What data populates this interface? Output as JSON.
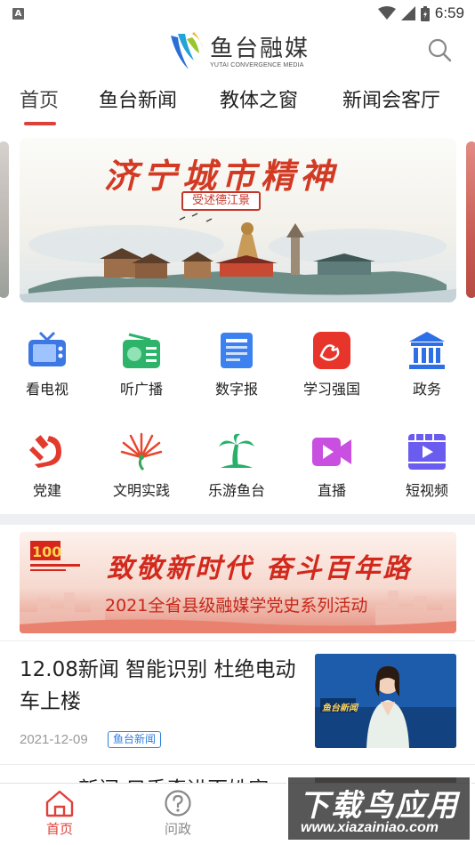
{
  "status_bar": {
    "time": "6:59",
    "app_icon_letter": "A"
  },
  "header": {
    "logo_cn": "鱼台融媒",
    "logo_en": "YUTAI CONVERGENCE MEDIA"
  },
  "tabs": [
    {
      "label": "首页",
      "active": true
    },
    {
      "label": "鱼台新闻",
      "active": false
    },
    {
      "label": "教体之窗",
      "active": false
    },
    {
      "label": "新闻会客厅",
      "active": false
    }
  ],
  "banner": {
    "title": "济宁城市精神",
    "subtitle": "受述德江景"
  },
  "grid": [
    {
      "label": "看电视",
      "icon": "tv-icon"
    },
    {
      "label": "听广播",
      "icon": "radio-icon"
    },
    {
      "label": "数字报",
      "icon": "newspaper-icon"
    },
    {
      "label": "学习强国",
      "icon": "xuexi-icon"
    },
    {
      "label": "政务",
      "icon": "government-icon"
    },
    {
      "label": "党建",
      "icon": "party-icon"
    },
    {
      "label": "文明实践",
      "icon": "civilization-icon"
    },
    {
      "label": "乐游鱼台",
      "icon": "palm-tree-icon"
    },
    {
      "label": "直播",
      "icon": "live-camera-icon"
    },
    {
      "label": "短视频",
      "icon": "short-video-icon"
    }
  ],
  "promo": {
    "title": "致敬新时代 奋斗百年路",
    "subtitle": "2021全省县级融媒学党史系列活动"
  },
  "news": [
    {
      "title": "12.08新闻 智能识别 杜绝电动车上楼",
      "date": "2021-12-09",
      "tag": "鱼台新闻",
      "thumb_caption": "鱼台新闻"
    },
    {
      "title": "新闻 只手牵进百姓家"
    }
  ],
  "bottom_nav": [
    {
      "label": "首页",
      "icon": "home-icon",
      "active": true
    },
    {
      "label": "问政",
      "icon": "question-icon",
      "active": false
    }
  ],
  "watermark": {
    "cn": "下载鸟应用",
    "en": "www.xiazainiao.com"
  },
  "colors": {
    "accent": "#e0403a",
    "tag_blue": "#2e7fe0"
  }
}
